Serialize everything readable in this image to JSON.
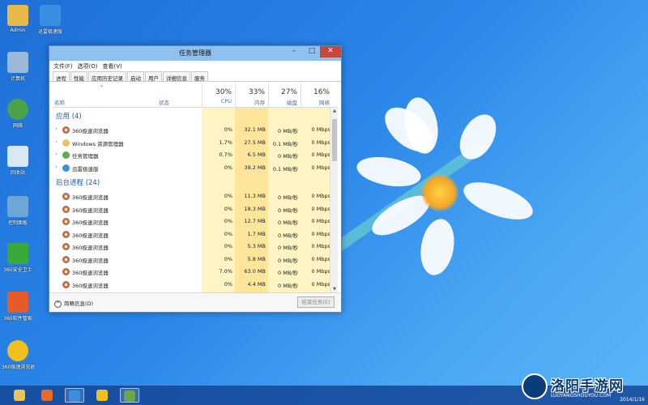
{
  "desktop": {
    "icons": [
      {
        "label": "Admin",
        "icon": "folder-icon",
        "color": "#e8b84a"
      },
      {
        "label": "迅雷极速版",
        "icon": "xunlei-icon",
        "color": "#3c8ee0"
      },
      {
        "label": "计算机",
        "icon": "computer-icon",
        "color": "#9ab8d8"
      },
      {
        "label": "网络",
        "icon": "network-icon",
        "color": "#4aa34a"
      },
      {
        "label": "回收站",
        "icon": "recycle-bin-icon",
        "color": "#d8e8f5"
      },
      {
        "label": "控制面板",
        "icon": "control-panel-icon",
        "color": "#6fa6d8"
      },
      {
        "label": "360安全卫士",
        "icon": "shield-plus-icon",
        "color": "#3aa83a"
      },
      {
        "label": "360软件管家",
        "icon": "software-manager-icon",
        "color": "#e85a2a"
      },
      {
        "label": "360极速浏览器",
        "icon": "browser-360-icon",
        "color": "#f0c020"
      }
    ]
  },
  "window": {
    "title": "任务管理器",
    "controls": {
      "minimize": "–",
      "maximize": "□",
      "close": "✕"
    },
    "menu": [
      "文件(F)",
      "选项(O)",
      "查看(V)"
    ],
    "tabs": [
      "进程",
      "性能",
      "应用历史记录",
      "启动",
      "用户",
      "详细信息",
      "服务"
    ],
    "active_tab": 0,
    "columns": {
      "name": "名称",
      "status": "状态",
      "sort_indicator": "^",
      "metrics": [
        {
          "pct": "30%",
          "label": "CPU"
        },
        {
          "pct": "33%",
          "label": "内存"
        },
        {
          "pct": "27%",
          "label": "磁盘"
        },
        {
          "pct": "16%",
          "label": "网络"
        }
      ]
    },
    "groups": [
      {
        "title": "应用 (4)",
        "rows": [
          {
            "name": "360极速浏览器",
            "icon": "browser-360-icon",
            "expandable": true,
            "cpu": "0%",
            "mem": "32.1 MB",
            "disk": "0 MB/秒",
            "net": "0 Mbps"
          },
          {
            "name": "Windows 资源管理器",
            "icon": "explorer-icon",
            "expandable": true,
            "cpu": "1.7%",
            "mem": "27.5 MB",
            "disk": "0.1 MB/秒",
            "net": "0 Mbps"
          },
          {
            "name": "任务管理器",
            "icon": "task-manager-icon",
            "expandable": true,
            "cpu": "0.7%",
            "mem": "6.5 MB",
            "disk": "0 MB/秒",
            "net": "0 Mbps"
          },
          {
            "name": "迅雷极速版",
            "icon": "xunlei-icon",
            "expandable": true,
            "cpu": "0%",
            "mem": "39.2 MB",
            "disk": "0.1 MB/秒",
            "net": "0 Mbps"
          }
        ]
      },
      {
        "title": "后台进程 (24)",
        "rows": [
          {
            "name": "360极速浏览器",
            "icon": "browser-360-icon",
            "expandable": false,
            "cpu": "0%",
            "mem": "11.3 MB",
            "disk": "0 MB/秒",
            "net": "0 Mbps"
          },
          {
            "name": "360极速浏览器",
            "icon": "browser-360-icon",
            "expandable": false,
            "cpu": "0%",
            "mem": "18.3 MB",
            "disk": "0 MB/秒",
            "net": "0 Mbps"
          },
          {
            "name": "360极速浏览器",
            "icon": "browser-360-icon",
            "expandable": false,
            "cpu": "0%",
            "mem": "12.7 MB",
            "disk": "0 MB/秒",
            "net": "0 Mbps"
          },
          {
            "name": "360极速浏览器",
            "icon": "browser-360-icon",
            "expandable": false,
            "cpu": "0%",
            "mem": "1.7 MB",
            "disk": "0 MB/秒",
            "net": "0 Mbps"
          },
          {
            "name": "360极速浏览器",
            "icon": "browser-360-icon",
            "expandable": false,
            "cpu": "0%",
            "mem": "5.3 MB",
            "disk": "0 MB/秒",
            "net": "0 Mbps"
          },
          {
            "name": "360极速浏览器",
            "icon": "browser-360-icon",
            "expandable": false,
            "cpu": "0%",
            "mem": "5.8 MB",
            "disk": "0 MB/秒",
            "net": "0 Mbps"
          },
          {
            "name": "360极速浏览器",
            "icon": "browser-360-icon",
            "expandable": false,
            "cpu": "7.0%",
            "mem": "63.0 MB",
            "disk": "0 MB/秒",
            "net": "0 Mbps"
          },
          {
            "name": "360极速浏览器",
            "icon": "browser-360-icon",
            "expandable": false,
            "cpu": "0%",
            "mem": "4.4 MB",
            "disk": "0 MB/秒",
            "net": "0 Mbps"
          }
        ]
      }
    ],
    "footer": {
      "fewer_details": "简略信息(D)",
      "fewer_icon": "^",
      "end_task": "结束任务(E)"
    },
    "colors": {
      "titlebar": "#8ec0f0",
      "heat_light": "#fff4c4",
      "heat_medium": "#fde69a",
      "group_title": "#1d5cb8"
    }
  },
  "taskbar": {
    "items": [
      {
        "icon": "file-explorer-icon",
        "color": "#e8c45a",
        "active": false
      },
      {
        "icon": "media-player-icon",
        "color": "#e86a2a",
        "active": false
      },
      {
        "icon": "xunlei-icon",
        "color": "#3c8ee0",
        "active": true
      },
      {
        "icon": "browser-360-icon",
        "color": "#f0c020",
        "active": false
      },
      {
        "icon": "task-manager-icon",
        "color": "#6aa84f",
        "active": true
      }
    ],
    "clock": "2014/1/16"
  },
  "watermark": {
    "text": "洛阳手游网",
    "url": "LUOYANGSHOUYOU.COM"
  }
}
